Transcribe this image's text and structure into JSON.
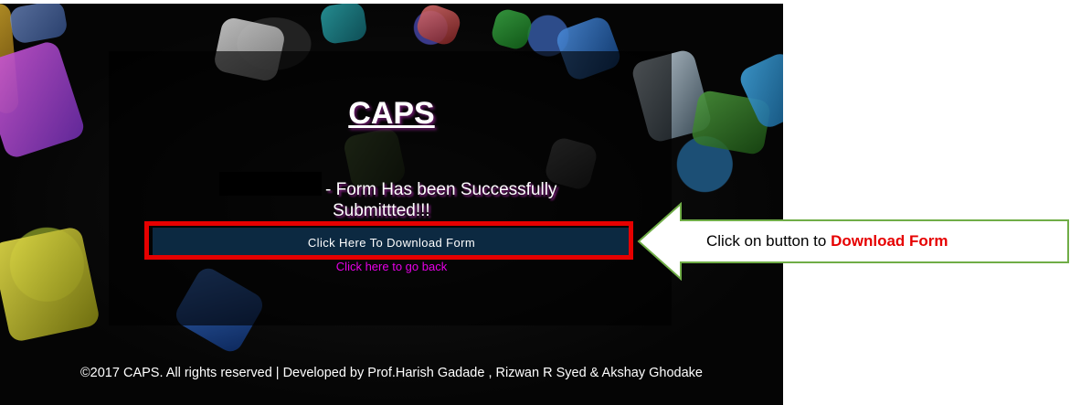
{
  "page": {
    "heading": "CAPS",
    "message_line1": "- Form Has been Successfully",
    "message_line2": "Submittted!!!",
    "download_button_label": "Click Here To Download Form",
    "back_link_label": "Click here to go back",
    "footer": "©2017 CAPS. All rights reserved | Developed by Prof.Harish Gadade , Rizwan R Syed & Akshay Ghodake"
  },
  "annotation": {
    "text_prefix": "Click on button to",
    "text_highlight": "Download Form",
    "highlight_color": "#e60000",
    "arrow_border_color": "#70ad47"
  },
  "colors": {
    "button_bg": "#0c2941",
    "link": "#e600e6",
    "panel": "rgba(0,0,0,0.62)"
  }
}
